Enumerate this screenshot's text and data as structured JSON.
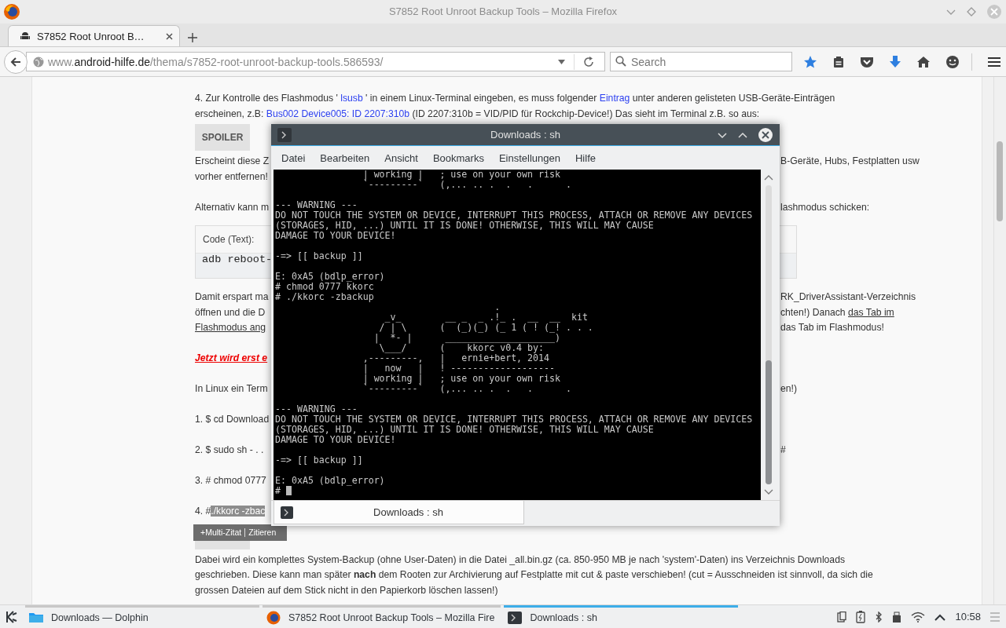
{
  "window": {
    "title": "S7852 Root Unroot Backup Tools – Mozilla Firefox"
  },
  "tabs": [
    {
      "label": "S7852 Root Unroot B…",
      "selected": true
    }
  ],
  "address_bar": {
    "url": [
      {
        "text": "www.",
        "kind": "dim"
      },
      {
        "text": "android-hilfe.de",
        "kind": "host"
      },
      {
        "text": "/thema/s7852-root-unroot-backup-tools.586593/",
        "kind": "dim"
      }
    ]
  },
  "search": {
    "placeholder": "Search"
  },
  "article": {
    "blocks": [
      {
        "kind": "paragraph",
        "lines": [
          {
            "left": [
              {
                "text": "4. Zur Kontrolle des Flashmodus ' ",
                "kind": "plain"
              },
              {
                "text": "lsusb",
                "kind": "link"
              },
              {
                "text": " ' in einem Linux-Terminal eingeben, es muss folgender ",
                "kind": "plain"
              },
              {
                "text": "Eintrag",
                "kind": "link"
              },
              {
                "text": " unter anderen gelisteten USB-Geräte-Einträgen\nerscheinen, z.B: ",
                "kind": "plain"
              },
              {
                "text": "Bus002 Device005: ID 2207:310b",
                "kind": "link"
              },
              {
                "text": " (ID 2207:310b = VID/PID für Rockchip-Device!) Das sieht im Terminal z.B. so aus:",
                "kind": "plain"
              }
            ]
          }
        ]
      },
      {
        "kind": "spoiler",
        "label": "SPOILER"
      },
      {
        "kind": "paragraph",
        "lines": [
          {
            "left": [
              {
                "text": "Erscheint diese Z",
                "kind": "plain"
              }
            ],
            "right": [
              {
                "text": "B-Geräte, Hubs, Festplatten usw",
                "kind": "plain"
              }
            ]
          },
          {
            "left": [
              {
                "text": "vorher entfernen!",
                "kind": "plain"
              }
            ]
          }
        ]
      },
      {
        "kind": "paragraph",
        "lines": [
          {
            "left": [
              {
                "text": "Alternativ kann m",
                "kind": "plain"
              }
            ],
            "right": [
              {
                "text": "lashmodus schicken:",
                "kind": "plain"
              }
            ]
          }
        ]
      },
      {
        "kind": "code",
        "label": "Code (Text):",
        "code": "adb reboot-"
      },
      {
        "kind": "paragraph",
        "lines": [
          {
            "left": [
              {
                "text": "Damit erspart ma",
                "kind": "plain"
              }
            ],
            "right": [
              {
                "text": "RK_DriverAssistant-Verzeichnis",
                "kind": "plain"
              }
            ]
          },
          {
            "left": [
              {
                "text": "öffnen und die D",
                "kind": "plain"
              }
            ],
            "right": [
              {
                "text": "chten!) Danach ",
                "kind": "plain"
              },
              {
                "text": "das Tab im",
                "kind": "underline"
              }
            ]
          },
          {
            "left": [
              {
                "text": "Flashmodus ang",
                "kind": "underline"
              }
            ],
            "right": [
              {
                "text": "das Tab im Flashmodus!",
                "kind": "plain"
              }
            ]
          }
        ]
      },
      {
        "kind": "paragraph",
        "lines": [
          {
            "left": [
              {
                "text": "Jetzt wird erst e",
                "kind": "alert"
              }
            ]
          }
        ]
      },
      {
        "kind": "paragraph",
        "lines": [
          {
            "left": [
              {
                "text": "In Linux ein Term",
                "kind": "plain"
              }
            ],
            "right": [
              {
                "text": "en!)",
                "kind": "plain"
              }
            ]
          }
        ]
      },
      {
        "kind": "paragraph",
        "lines": [
          {
            "left": [
              {
                "text": "1. $ cd Download",
                "kind": "plain"
              }
            ]
          }
        ]
      },
      {
        "kind": "paragraph",
        "lines": [
          {
            "left": [
              {
                "text": "2. $ sudo sh - . .",
                "kind": "plain"
              }
            ],
            "right": [
              {
                "text": "#",
                "kind": "plain"
              }
            ]
          }
        ]
      },
      {
        "kind": "paragraph",
        "lines": [
          {
            "left": [
              {
                "text": "3. # chmod 0777",
                "kind": "plain"
              }
            ]
          }
        ]
      },
      {
        "kind": "paragraph",
        "lines": [
          {
            "left": [
              {
                "text": "4. #",
                "kind": "plain"
              },
              {
                "text": "./kkorc -zbac",
                "kind": "highlight"
              }
            ]
          }
        ]
      },
      {
        "kind": "actions",
        "items": [
          "+Multi-Zitat",
          "Zitieren"
        ]
      },
      {
        "kind": "spoiler_covered"
      },
      {
        "kind": "paragraph",
        "lines": [
          {
            "left": [
              {
                "text": "Dabei wird ein komplettes System-Backup (ohne User-Daten) in die Datei _all.bin.gz (ca. 850-950 MB je nach 'system'-Daten) ins Verzeichnis Downloads\ngeschrieben. Diese kann man später ",
                "kind": "plain"
              },
              {
                "text": "nach",
                "kind": "bold"
              },
              {
                "text": " dem Rooten zur Archivierung auf Festplatte mit cut & paste verschieben! (cut = Ausschneiden ist sinnvoll, da sich die\ngrossen Dateien auf dem Stick nicht in den Papierkorb löschen lassen!)",
                "kind": "plain"
              }
            ]
          }
        ]
      }
    ]
  },
  "terminal": {
    "title": "Downloads : sh",
    "menu": [
      "Datei",
      "Bearbeiten",
      "Ansicht",
      "Bookmarks",
      "Einstellungen",
      "Hilfe"
    ],
    "blocks": [
      [
        "                | working |   ; use on your own risk",
        "                `---------`   (,... .. .  .   .      ."
      ],
      [
        "--- WARNING ---",
        "DO NOT TOUCH THE SYSTEM OR DEVICE, INTERRUPT THIS PROCESS, ATTACH OR REMOVE ANY DEVICES",
        "(STORAGES, HID, ...) UNTIL IT IS DONE! OTHERWISE, THIS WILL MAY CAUSE",
        "DAMAGE TO YOUR DEVICE!"
      ],
      [
        "-=> [[ backup ]]"
      ],
      [
        "E: 0xA5 (bdlp_error)",
        "# chmod 0777 kkorc",
        "# ./kkorc -zbackup",
        "                                        .",
        "                    _v_        __ _  _ .!_ .  __  __  kit",
        "                   / | \\      (  (_)(_) (_ 1 ( ! (_! . . .",
        "                  |  *- |      ____________________)",
        "                   \\___/      (    kkorc v0.4 by:",
        "                ,---------,   |   ernie+bert, 2014",
        "                |   now   |   ! -------------------",
        "                | working |   ; use on your own risk",
        "                `---------`   (,... .. .  .   .      ."
      ],
      [
        "--- WARNING ---",
        "DO NOT TOUCH THE SYSTEM OR DEVICE, INTERRUPT THIS PROCESS, ATTACH OR REMOVE ANY DEVICES",
        "(STORAGES, HID, ...) UNTIL IT IS DONE! OTHERWISE, THIS WILL MAY CAUSE",
        "DAMAGE TO YOUR DEVICE!"
      ],
      [
        "-=> [[ backup ]]"
      ],
      [
        "E: 0xA5 (bdlp_error)"
      ]
    ],
    "prompt": "#",
    "tabs": [
      {
        "label": "Downloads : sh",
        "selected": true
      }
    ]
  },
  "taskbar": {
    "tasks": [
      {
        "label": "Downloads — Dolphin",
        "kind": "folder",
        "selected": false
      },
      {
        "label": "S7852 Root Unroot Backup Tools – Mozilla Fire",
        "kind": "browser",
        "selected": false
      },
      {
        "label": "Downloads : sh",
        "kind": "terminal",
        "selected": true
      }
    ],
    "clock": "10:58"
  }
}
